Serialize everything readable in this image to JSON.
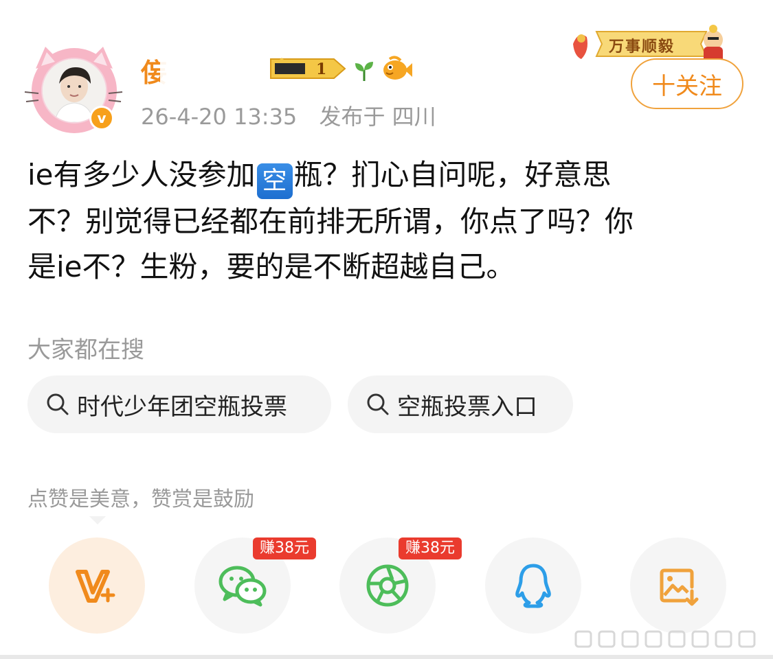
{
  "user": {
    "name_visible": "侫",
    "name_tail": "",
    "post_time": "26-4-20 13:35",
    "post_location": "发布于 四川",
    "verified_badge": "v"
  },
  "banner": {
    "text": "万事顺毅"
  },
  "follow_button": {
    "label": "十关注"
  },
  "post": {
    "line_1_before": "ie有多少人没参加",
    "emoji": "空",
    "line_1_after": "瓶？扪心自问呢，好意思",
    "line_2": "不？别觉得已经都在前排无所谓，你点了吗？你",
    "line_3": "是ie不？生粉，要的是不断超越自己。"
  },
  "trending": {
    "title": "大家都在搜",
    "chips": [
      {
        "label": "时代少年团空瓶投票"
      },
      {
        "label": "空瓶投票入口"
      }
    ]
  },
  "reward": {
    "hint": "点赞是美意，赞赏是鼓励"
  },
  "share": {
    "items": [
      {
        "name": "vplus",
        "icon": "vplus-icon"
      },
      {
        "name": "wechat",
        "icon": "wechat-icon",
        "tag": "赚38元"
      },
      {
        "name": "moments",
        "icon": "moments-icon",
        "tag": "赚38元"
      },
      {
        "name": "qq",
        "icon": "qq-icon"
      },
      {
        "name": "save-image",
        "icon": "save-image-icon"
      }
    ]
  },
  "colors": {
    "accent": "#f08a1c",
    "follow_border": "#f0a23c",
    "meta_gray": "#9a9a9a",
    "earn_red": "#ea3b2e",
    "wechat_green": "#4dbd5a",
    "qq_blue": "#2d9ee8",
    "chip_bg": "#f4f4f4"
  }
}
